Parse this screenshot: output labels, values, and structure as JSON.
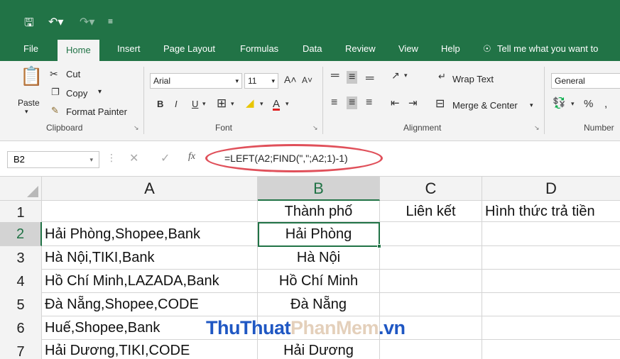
{
  "tabs": [
    "File",
    "Home",
    "Insert",
    "Page Layout",
    "Formulas",
    "Data",
    "Review",
    "View",
    "Help"
  ],
  "tell_me": "Tell me what you want to",
  "clipboard": {
    "paste": "Paste",
    "cut": "Cut",
    "copy": "Copy",
    "format_painter": "Format Painter",
    "group": "Clipboard"
  },
  "font": {
    "name": "Arial",
    "size": "11",
    "group": "Font",
    "bold": "B",
    "italic": "I",
    "underline": "U"
  },
  "alignment": {
    "wrap": "Wrap Text",
    "merge": "Merge & Center",
    "group": "Alignment"
  },
  "number": {
    "format": "General",
    "group": "Number",
    "percent": "%"
  },
  "name_box": "B2",
  "formula": "=LEFT(A2;FIND(\",\";A2;1)-1)",
  "fx": "fx",
  "columns": [
    "A",
    "B",
    "C",
    "D"
  ],
  "rows": [
    "1",
    "2",
    "3",
    "4",
    "5",
    "6",
    "7"
  ],
  "cells": {
    "B1": "Thành phố",
    "C1": "Liên kết",
    "D1": "Hình thức trả tiền",
    "A2": "Hải Phòng,Shopee,Bank",
    "B2": "Hải Phòng",
    "A3": "Hà Nội,TIKI,Bank",
    "B3": "Hà Nội",
    "A4": "Hồ Chí Minh,LAZADA,Bank",
    "B4": "Hồ Chí Minh",
    "A5": "Đà Nẵng,Shopee,CODE",
    "B5": "Đà Nẵng",
    "A6": "Huế,Shopee,Bank",
    "A7": "Hải Dương,TIKI,CODE",
    "B7": "Hải Dương"
  },
  "watermark": {
    "part1": "ThuThuat",
    "part2": "PhanMem",
    "part3": ".vn"
  },
  "colors": {
    "accent": "#217346",
    "highlight": "#e0505a"
  }
}
